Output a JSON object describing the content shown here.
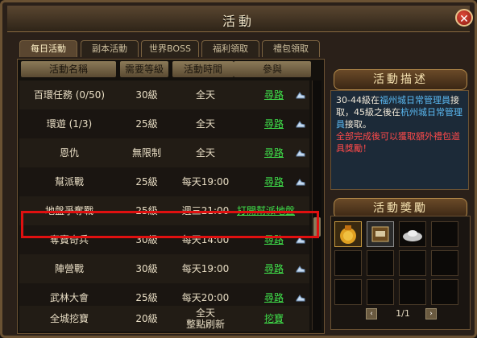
{
  "window": {
    "title": "活動"
  },
  "tabs": [
    {
      "label": "每日活動",
      "active": true
    },
    {
      "label": "副本活動",
      "active": false
    },
    {
      "label": "世界BOSS",
      "active": false
    },
    {
      "label": "福利領取",
      "active": false
    },
    {
      "label": "禮包領取",
      "active": false
    }
  ],
  "table": {
    "headers": [
      "活動名稱",
      "需要等級",
      "活動時間",
      "參與"
    ],
    "rows": [
      {
        "name": "百環任務 (0/50)",
        "level": "30級",
        "time": "全天",
        "action": "尋路"
      },
      {
        "name": "環遊 (1/3)",
        "level": "25級",
        "time": "全天",
        "action": "尋路"
      },
      {
        "name": "恩仇",
        "level": "無限制",
        "time": "全天",
        "action": "尋路"
      },
      {
        "name": "幫派戰",
        "level": "25級",
        "time": "每天19:00",
        "action": "尋路"
      },
      {
        "name": "地盤爭奪戰",
        "level": "25級",
        "time": "週三21:00",
        "action": "打開幫派地盤"
      },
      {
        "name": "奪寶奇兵",
        "level": "30級",
        "time": "每天14:00",
        "action": "尋路"
      },
      {
        "name": "陣營戰",
        "level": "30級",
        "time": "每天19:00",
        "action": "尋路"
      },
      {
        "name": "武林大會",
        "level": "25級",
        "time": "每天20:00",
        "action": "尋路"
      },
      {
        "name": "全城挖寶",
        "level": "20級",
        "time_line1": "全天",
        "time_line2": "整點刷新",
        "action": "挖寶"
      }
    ]
  },
  "description": {
    "heading": "活動描述",
    "part1": "30-44級在",
    "part2": "福州城日常管理員",
    "part3": "接取，45級之後在",
    "part4": "杭州城日常管理員",
    "part5": "接取。",
    "note": "全部完成後可以獲取額外禮包道具獎勵！"
  },
  "rewards": {
    "heading": "活動獎勵",
    "page": "1/1",
    "items": [
      "money-bag-icon",
      "scroll-icon",
      "silver-ingot-icon"
    ]
  },
  "colors": {
    "link": "#3fe04a",
    "highlight": "#e01010",
    "desc_blue": "#5ab8f0",
    "desc_red": "#ff4a4a"
  }
}
